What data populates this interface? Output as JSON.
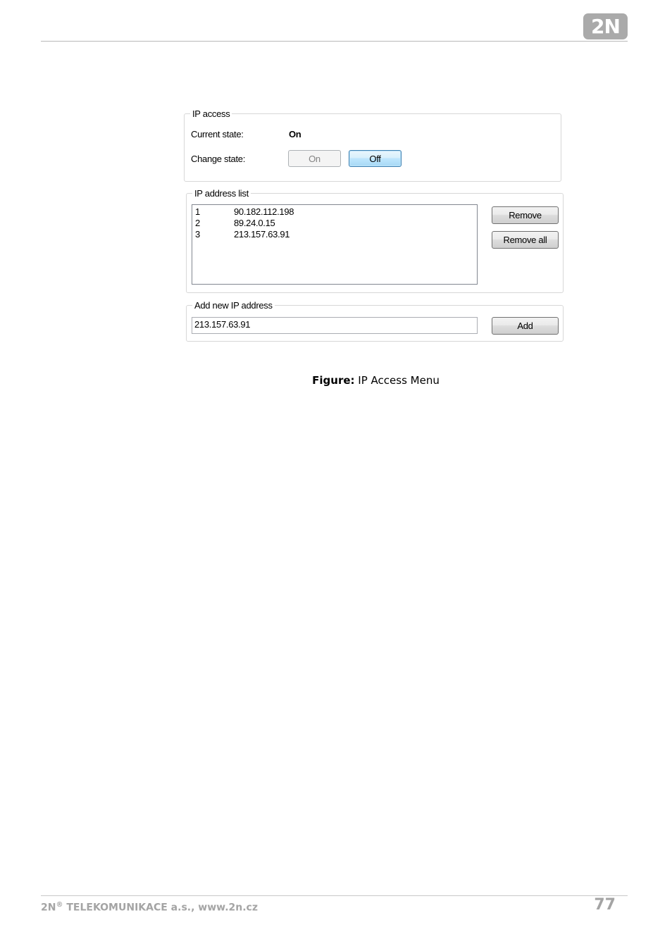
{
  "header": {
    "logo_text": "2N"
  },
  "ip_access": {
    "title": "IP access",
    "current_state_label": "Current state:",
    "current_state_value": "On",
    "change_state_label": "Change state:",
    "on_button": "On",
    "off_button": "Off"
  },
  "ip_address_list": {
    "title": "IP address list",
    "rows": [
      {
        "index": "1",
        "ip": "90.182.112.198"
      },
      {
        "index": "2",
        "ip": "89.24.0.15"
      },
      {
        "index": "3",
        "ip": "213.157.63.91"
      }
    ],
    "remove_button": "Remove",
    "remove_all_button": "Remove all"
  },
  "add_new": {
    "title": "Add new IP address",
    "input_value": "213.157.63.91",
    "add_button": "Add"
  },
  "caption": {
    "prefix": "Figure:",
    "text": " IP Access Menu"
  },
  "footer": {
    "brand": "2N",
    "registered": "®",
    "company": " TELEKOMUNIKACE a.s., www.2n.cz",
    "page_number": "77"
  }
}
